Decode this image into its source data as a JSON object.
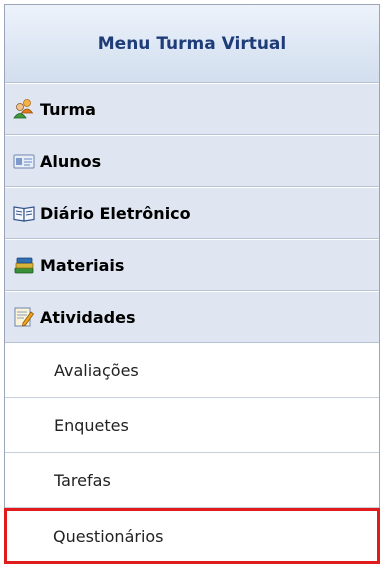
{
  "menu": {
    "title": "Menu Turma Virtual",
    "sections": [
      {
        "label": "Turma",
        "icon": "people-icon"
      },
      {
        "label": "Alunos",
        "icon": "id-card-icon"
      },
      {
        "label": "Diário Eletrônico",
        "icon": "open-book-icon"
      },
      {
        "label": "Materiais",
        "icon": "books-stack-icon"
      },
      {
        "label": "Atividades",
        "icon": "edit-document-icon"
      }
    ],
    "subitems": [
      {
        "label": "Avaliações"
      },
      {
        "label": "Enquetes"
      },
      {
        "label": "Tarefas"
      },
      {
        "label": "Questionários",
        "highlighted": true
      }
    ]
  },
  "colors": {
    "title_text": "#1e3c78",
    "section_bg": "#dfe6f1",
    "highlight_border": "#e01b1b"
  }
}
